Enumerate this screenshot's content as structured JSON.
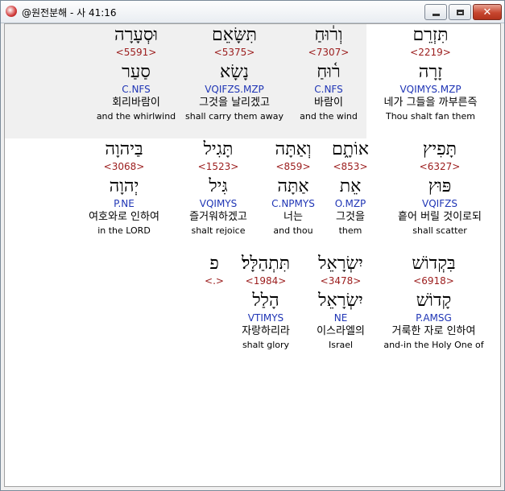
{
  "window": {
    "title": "@원전분해 - 사 41:16"
  },
  "rows": [
    [
      {
        "heb": "תִּזְרֵם",
        "strong": "<2219>",
        "lemma": "זָרָה",
        "morph": "VQIMYS.MZP",
        "korean": "네가 그들을 까부른즉",
        "english": "Thou shalt fan them",
        "highlight": true
      },
      {
        "heb": "וְר֔וּחַ",
        "strong": "<7307>",
        "lemma": "ר֫וּחַ",
        "morph": "C.NFS",
        "korean": "바람이",
        "english": "and the wind",
        "highlight": false
      },
      {
        "heb": "תִּשָּׂאֵם",
        "strong": "<5375>",
        "lemma": "נָשָׂא",
        "morph": "VQIFZS.MZP",
        "korean": "그것을 날리겠고",
        "english": "shall carry them away",
        "highlight": false
      },
      {
        "heb": "וּסְעָרָה",
        "strong": "<5591>",
        "lemma": "סַעַר",
        "morph": "C.NFS",
        "korean": "회리바람이",
        "english": "and the whirlwind",
        "highlight": false
      }
    ],
    [
      {
        "heb": "תָּפִיץ",
        "strong": "<6327>",
        "lemma": "פּוּץ",
        "morph": "VQIFZS",
        "korean": "흩어 버릴 것이로되",
        "english": "shall scatter",
        "highlight": false
      },
      {
        "heb": "אוֹתָ֑ם",
        "strong": "<853>",
        "lemma": "אֵת",
        "morph": "O.MZP",
        "korean": "그것을",
        "english": "them",
        "highlight": false
      },
      {
        "heb": "וְאַתָּה",
        "strong": "<859>",
        "lemma": "אַתָּה",
        "morph": "C.NPMYS",
        "korean": "너는",
        "english": "and thou",
        "highlight": false
      },
      {
        "heb": "תָּגִיל",
        "strong": "<1523>",
        "lemma": "גִּיל",
        "morph": "VQIMYS",
        "korean": "즐거워하겠고",
        "english": "shalt rejoice",
        "highlight": false
      },
      {
        "heb": "בַּיהוָה",
        "strong": "<3068>",
        "lemma": "יְהוָה",
        "morph": "P.NE",
        "korean": "여호와로 인하여",
        "english": "in the LORD",
        "highlight": false
      }
    ],
    [
      {
        "heb": "בִּקְדוֹשׁ",
        "strong": "<6918>",
        "lemma": "קָדוֹשׁ",
        "morph": "P.AMSG",
        "korean": "거룩한 자로 인하여",
        "english": "and-in the Holy One of",
        "highlight": false
      },
      {
        "heb": "יִשְׂרָאֵל",
        "strong": "<3478>",
        "lemma": "יִשְׂרָאֵל",
        "morph": "NE",
        "korean": "이스라엘의",
        "english": "Israel",
        "highlight": false
      },
      {
        "heb": "תִּתְהַלָּל׃",
        "strong": "<1984>",
        "lemma": "הָלַל",
        "morph": "VTIMYS",
        "korean": "자랑하리라",
        "english": "shalt glory",
        "highlight": false
      },
      {
        "heb": "פ",
        "strong": "<.>",
        "lemma": "",
        "morph": "",
        "korean": "",
        "english": "",
        "highlight": false
      }
    ]
  ]
}
